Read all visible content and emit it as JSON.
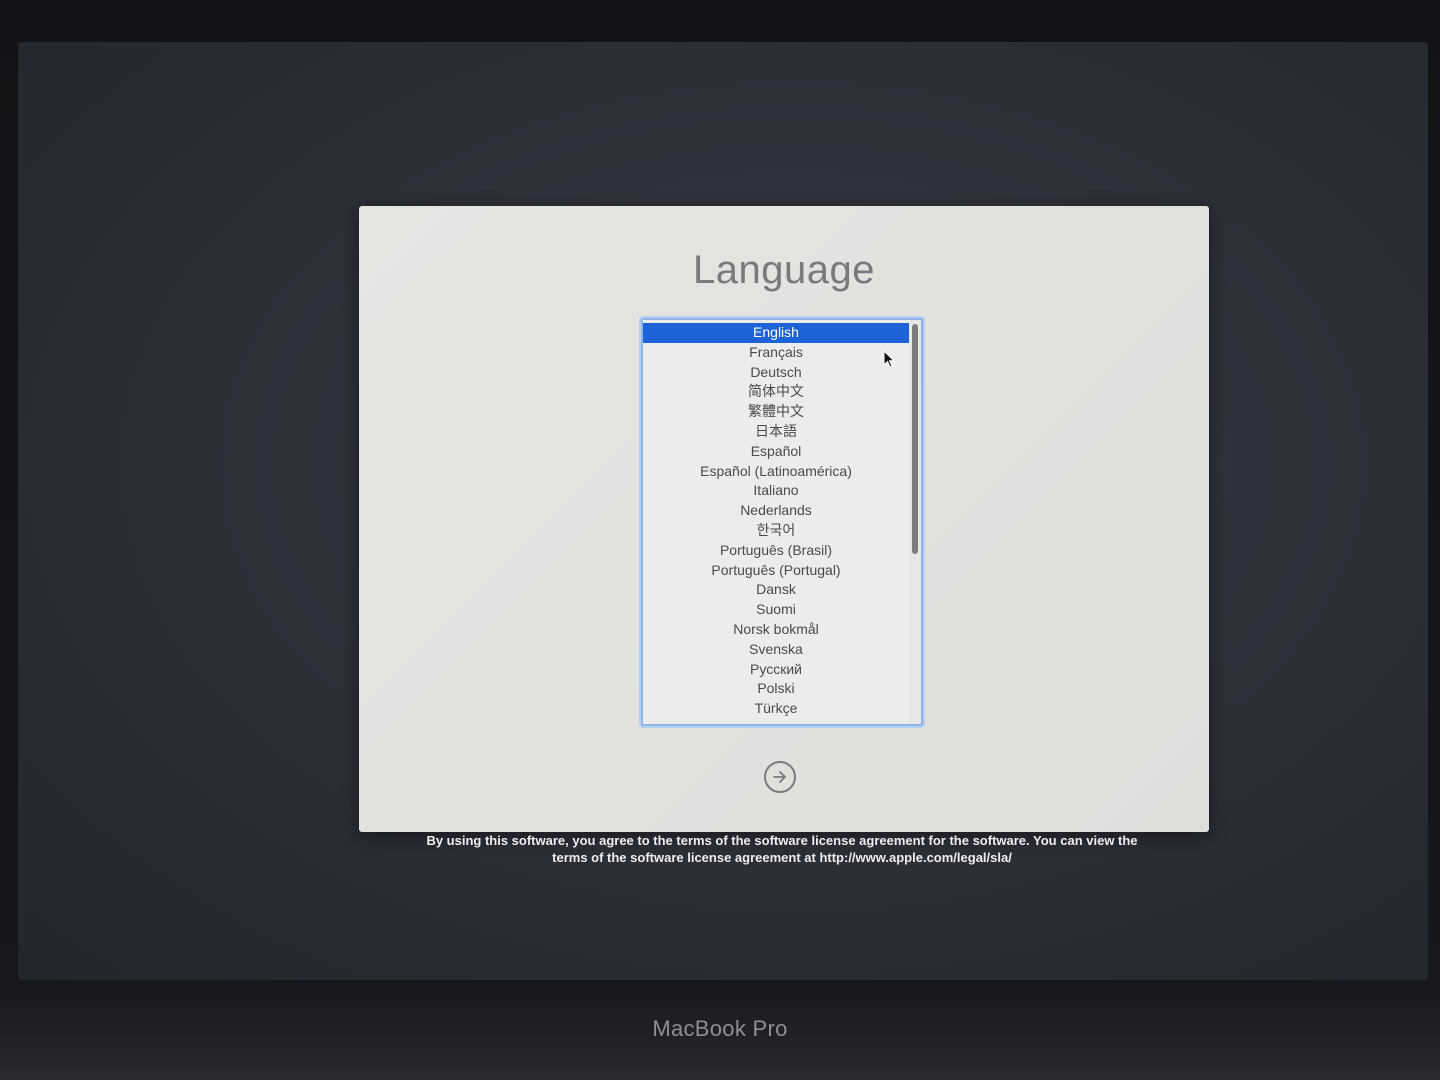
{
  "window": {
    "title": "Language"
  },
  "language_list": {
    "items": [
      "English",
      "Français",
      "Deutsch",
      "简体中文",
      "繁體中文",
      "日本語",
      "Español",
      "Español (Latinoamérica)",
      "Italiano",
      "Nederlands",
      "한국어",
      "Português (Brasil)",
      "Português (Portugal)",
      "Dansk",
      "Suomi",
      "Norsk bokmål",
      "Svenska",
      "Русский",
      "Polski",
      "Türkçe"
    ],
    "selected": "English"
  },
  "next_button": {
    "icon": "arrow-right-circle-icon"
  },
  "license": {
    "line1": "By using this software, you agree to the terms of the software license agreement for the software. You can view the",
    "line2": "terms of the software license agreement at http://www.apple.com/legal/sla/"
  },
  "device": {
    "label": "MacBook Pro"
  },
  "colors": {
    "selection": "#1c63d8",
    "focus_ring": "#8eb5e6",
    "screen_background": "#2c2e38",
    "window_background": "#e3e2df"
  }
}
